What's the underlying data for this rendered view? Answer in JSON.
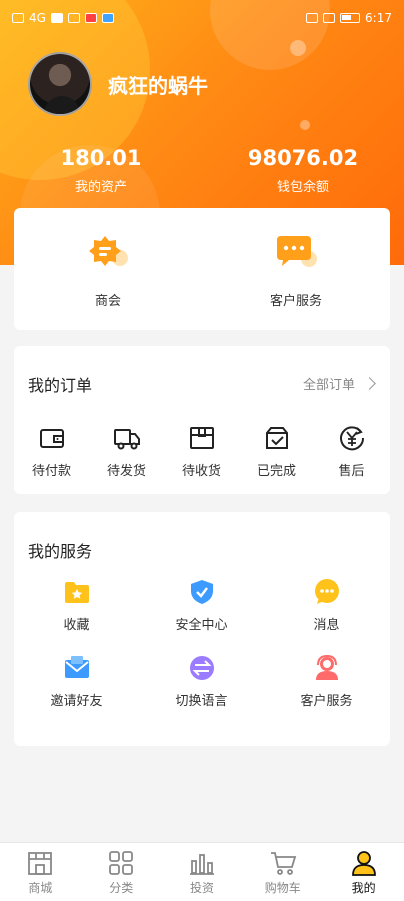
{
  "status_bar": {
    "time": "6:17",
    "signal": "4G"
  },
  "profile": {
    "username": "疯狂的蜗牛"
  },
  "stats": [
    {
      "value": "180.01",
      "label": "我的资产"
    },
    {
      "value": "98076.02",
      "label": "钱包余额"
    }
  ],
  "top_services": [
    {
      "label": "商会",
      "icon": "badge-icon"
    },
    {
      "label": "客户服务",
      "icon": "chat-bubble-icon"
    }
  ],
  "orders": {
    "title": "我的订单",
    "all_link": "全部订单",
    "items": [
      {
        "label": "待付款",
        "icon": "wallet-icon"
      },
      {
        "label": "待发货",
        "icon": "truck-icon"
      },
      {
        "label": "待收货",
        "icon": "package-icon"
      },
      {
        "label": "已完成",
        "icon": "check-box-icon"
      },
      {
        "label": "售后",
        "icon": "yen-refund-icon"
      }
    ]
  },
  "services": {
    "title": "我的服务",
    "items": [
      {
        "label": "收藏",
        "icon": "folder-star-icon"
      },
      {
        "label": "安全中心",
        "icon": "shield-check-icon"
      },
      {
        "label": "消息",
        "icon": "message-icon"
      },
      {
        "label": "邀请好友",
        "icon": "envelope-icon"
      },
      {
        "label": "切换语言",
        "icon": "switch-icon"
      },
      {
        "label": "客户服务",
        "icon": "headset-icon"
      }
    ]
  },
  "tabbar": {
    "active": "我的",
    "items": [
      {
        "label": "商城",
        "icon": "store-icon"
      },
      {
        "label": "分类",
        "icon": "grid-icon"
      },
      {
        "label": "投资",
        "icon": "bar-chart-icon"
      },
      {
        "label": "购物车",
        "icon": "cart-icon"
      },
      {
        "label": "我的",
        "icon": "user-icon"
      }
    ]
  },
  "colors": {
    "accent": "#ff8a14",
    "accent_light": "#ffb11a",
    "icon_orange": "#ff9f1a",
    "icon_yellow": "#ffc21a",
    "icon_blue": "#3d9bff",
    "icon_purple": "#9b7bff",
    "icon_red": "#ff6a6a"
  }
}
